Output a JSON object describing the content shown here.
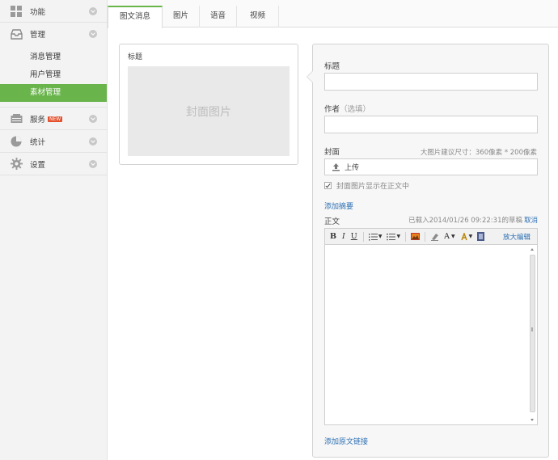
{
  "sidebar": {
    "items": [
      {
        "label": "功能",
        "icon": "grid-icon"
      },
      {
        "label": "管理",
        "icon": "inbox-icon"
      },
      {
        "label": "服务",
        "icon": "service-icon",
        "badge": "NEW"
      },
      {
        "label": "统计",
        "icon": "pie-chart-icon"
      },
      {
        "label": "设置",
        "icon": "gear-icon"
      }
    ],
    "sub_items": [
      "消息管理",
      "用户管理",
      "素材管理"
    ],
    "active_sub": "素材管理"
  },
  "tabs": [
    "图文消息",
    "图片",
    "语音",
    "视频"
  ],
  "active_tab": "图文消息",
  "preview": {
    "title_label": "标题",
    "cover_text": "封面图片"
  },
  "form": {
    "title_label": "标题",
    "author_label": "作者",
    "author_hint": "（选填）",
    "cover_label": "封面",
    "cover_hint": "大图片建议尺寸：360像素 * 200像素",
    "upload_label": "上传",
    "show_cover_label": "封面图片显示在正文中",
    "add_summary": "添加摘要",
    "body_label": "正文",
    "autosave_text": "已载入2014/01/26 09:22:31的草稿",
    "autosave_cancel": "取消",
    "toolbar_bold": "B",
    "toolbar_italic": "I",
    "toolbar_underline": "U",
    "toolbar_font": "A",
    "toolbar_fullscreen": "放大编辑",
    "add_source": "添加原文链接"
  },
  "colors": {
    "accent": "#6ab44c",
    "link": "#2c6fb3",
    "badge": "#e2502d"
  }
}
